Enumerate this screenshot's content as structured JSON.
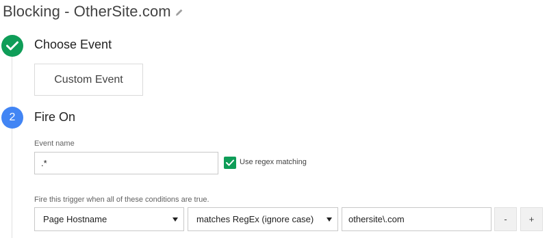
{
  "header": {
    "title": "Blocking - OtherSite.com",
    "edit_icon": "pencil-icon"
  },
  "steps": [
    {
      "marker": "check-icon",
      "marker_color": "#0f9d58",
      "title": "Choose Event"
    },
    {
      "marker": "2",
      "marker_color": "#4285f4",
      "title": "Fire On"
    }
  ],
  "choose_event": {
    "selected_event": "Custom Event"
  },
  "fire_on": {
    "event_name_label": "Event name",
    "event_name_value": ".*",
    "use_regex_checked": true,
    "use_regex_label": "Use regex matching",
    "conditions_label": "Fire this trigger when all of these conditions are true.",
    "conditions": [
      {
        "variable": "Page Hostname",
        "operator": "matches RegEx (ignore case)",
        "value": "othersite\\.com",
        "remove_label": "-",
        "add_label": "+"
      }
    ]
  },
  "colors": {
    "success_green": "#0f9d58",
    "step_blue": "#4285f4"
  }
}
